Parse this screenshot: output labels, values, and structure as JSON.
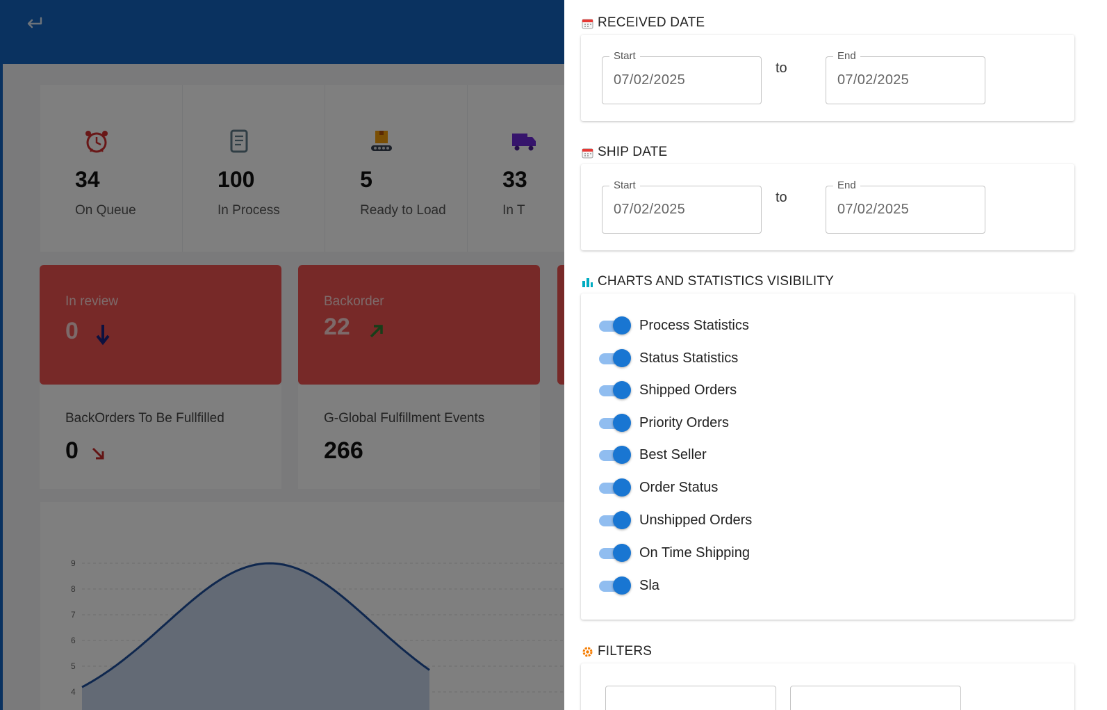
{
  "stats": [
    {
      "value": "34",
      "label": "On Queue",
      "icon": "alarm-clock-icon"
    },
    {
      "value": "100",
      "label": "In Process",
      "icon": "document-icon"
    },
    {
      "value": "5",
      "label": "Ready to Load",
      "icon": "conveyor-box-icon"
    },
    {
      "value": "33",
      "label": "In T",
      "icon": "truck-icon"
    }
  ],
  "alert_cards": [
    {
      "title": "In review",
      "value": "0",
      "trend": "down"
    },
    {
      "title": "Backorder",
      "value": "22",
      "trend": "up"
    }
  ],
  "info_cards": [
    {
      "title": "BackOrders To Be Fullfilled",
      "value": "0",
      "trend": "down-right"
    },
    {
      "title": "G-Global Fulfillment Events",
      "value": "266",
      "trend": "none"
    }
  ],
  "chart_data": {
    "type": "area",
    "yticks": [
      "9",
      "8",
      "7",
      "6",
      "5",
      "4"
    ],
    "ylim": [
      4,
      9
    ],
    "colors": {
      "line": "#1e4f9c",
      "fill": "#c6d4ea"
    }
  },
  "drawer": {
    "received_date": {
      "title": "RECEIVED DATE",
      "start_label": "Start",
      "start_value": "07/02/2025",
      "to": "to",
      "end_label": "End",
      "end_value": "07/02/2025"
    },
    "ship_date": {
      "title": "SHIP DATE",
      "start_label": "Start",
      "start_value": "07/02/2025",
      "to": "to",
      "end_label": "End",
      "end_value": "07/02/2025"
    },
    "visibility": {
      "title": "CHARTS AND STATISTICS VISIBILITY",
      "toggles": [
        {
          "label": "Process Statistics",
          "on": true
        },
        {
          "label": "Status Statistics",
          "on": true
        },
        {
          "label": "Shipped Orders",
          "on": true
        },
        {
          "label": "Priority Orders",
          "on": true
        },
        {
          "label": "Best Seller",
          "on": true
        },
        {
          "label": "Order Status",
          "on": true
        },
        {
          "label": "Unshipped Orders",
          "on": true
        },
        {
          "label": "On Time Shipping",
          "on": true
        },
        {
          "label": "Sla",
          "on": true
        }
      ]
    },
    "filters": {
      "title": "FILTERS"
    }
  },
  "colors": {
    "appbar": "#1565c0",
    "alert_card": "#ef5350",
    "toggle_on": "#1976d2"
  }
}
